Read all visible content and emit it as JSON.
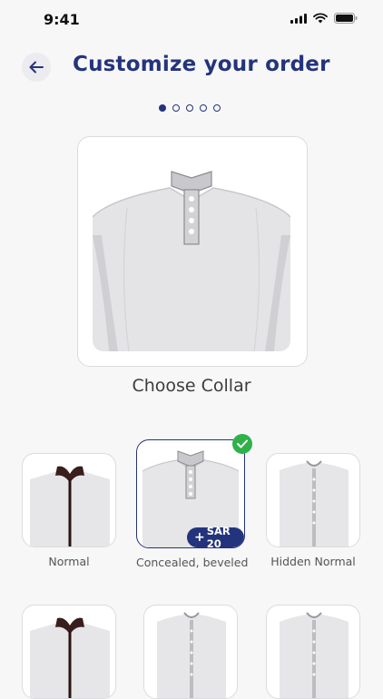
{
  "status": {
    "time": "9:41"
  },
  "header": {
    "title": "Customize your order"
  },
  "steps": {
    "total": 5,
    "current": 1
  },
  "section": {
    "title": "Choose Collar"
  },
  "options": [
    {
      "label": "Normal",
      "price": ""
    },
    {
      "label": "Concealed, beveled",
      "price": "SAR 20",
      "selected": true
    },
    {
      "label": "Hidden Normal",
      "price": ""
    }
  ],
  "colors": {
    "accent": "#24347c",
    "check": "#2fb14a"
  }
}
